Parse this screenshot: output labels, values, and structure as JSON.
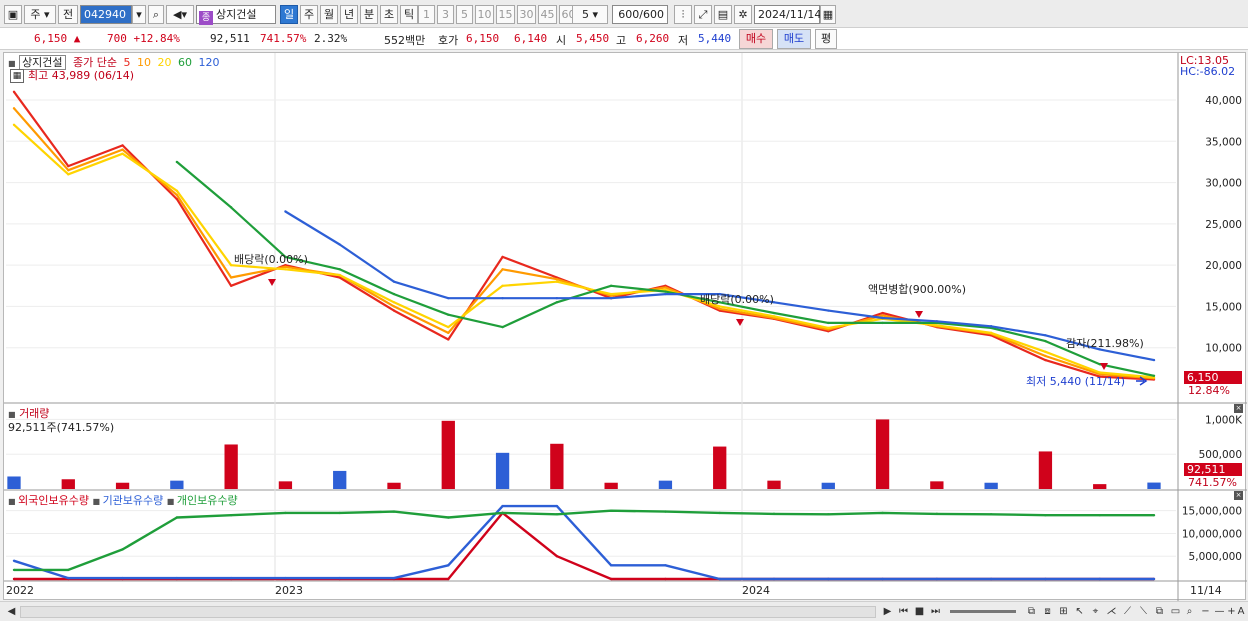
{
  "toolbar": {
    "market": "주",
    "scope": "전",
    "stock_code": "042940",
    "stock_badge": "종",
    "stock_name": "상지건설",
    "periods": [
      "일",
      "주",
      "월",
      "년",
      "분",
      "초",
      "틱"
    ],
    "selected_period": "일",
    "intervals": [
      "1",
      "3",
      "5",
      "10",
      "15",
      "30",
      "45",
      "60"
    ],
    "interval_value": "5",
    "count": "600/600",
    "date": "2024/11/14"
  },
  "quote": {
    "price": "6,150 ▲",
    "change": "700 +12.84%",
    "volume": "92,511",
    "volume_ratio": "741.57%",
    "turnover": "2.32%",
    "amount": "552백만",
    "bid_label": "호가",
    "bid1": "6,150",
    "bid2": "6,140",
    "open_label": "시",
    "open": "5,450",
    "high_label": "고",
    "high": "6,260",
    "low_label": "저",
    "low": "5,440",
    "buy_label": "매수",
    "sell_label": "매도",
    "flat_label": "평"
  },
  "price_panel": {
    "name": "상지건설",
    "indicator": "종가 단순",
    "ma_periods": [
      "5",
      "10",
      "20",
      "60",
      "120"
    ],
    "ma_colors": [
      "#e8281e",
      "#ff9a00",
      "#ffd400",
      "#1f9e3a",
      "#2d5fd6"
    ],
    "max_label": "최고 43,989 (06/14)",
    "min_label": "최저 5,440 (11/14)",
    "lc": "LC:13.05",
    "hc": "HC:-86.02",
    "current_price_tag": "6,150",
    "current_pct_tag": "12.84%",
    "events": [
      {
        "label": "배당락(0.00%)"
      },
      {
        "label": "배당락(0.00%)"
      },
      {
        "label": "액면병합(900.00%)"
      },
      {
        "label": "감자(211.98%)"
      }
    ]
  },
  "volume_panel": {
    "title": "거래량",
    "value_label": "92,511주(741.57%)",
    "current_tag": "92,511",
    "current_pct": "741.57%"
  },
  "holdings_panel": {
    "series_labels": [
      "외국인보유수량",
      "기관보유수량",
      "개인보유수량"
    ],
    "series_colors": [
      "#d0021b",
      "#2d5fd6",
      "#1f9e3a"
    ]
  },
  "x_axis": {
    "labels": [
      "2022",
      "2023",
      "2024"
    ],
    "last_label": "11/14"
  },
  "chart_data": [
    {
      "type": "line",
      "series": [
        {
          "name": "5",
          "values": [
            41000,
            32000,
            34500,
            28000,
            17500,
            20000,
            18500,
            14500,
            11000,
            21000,
            18500,
            16000,
            17500,
            14500,
            13500,
            12000,
            14200,
            12500,
            11500,
            8500,
            6500,
            6150
          ]
        },
        {
          "name": "10",
          "values": [
            39000,
            31500,
            34000,
            28500,
            18500,
            19800,
            18800,
            15000,
            11800,
            19500,
            18300,
            16300,
            17300,
            14700,
            13600,
            12200,
            13900,
            12600,
            11700,
            9000,
            6800,
            6300
          ]
        },
        {
          "name": "20",
          "values": [
            37000,
            31000,
            33500,
            29000,
            20000,
            19500,
            18800,
            15500,
            12500,
            17500,
            18000,
            16500,
            17000,
            15000,
            13800,
            12400,
            13500,
            12700,
            11800,
            9500,
            7000,
            6400
          ]
        },
        {
          "name": "60",
          "values": [
            null,
            null,
            null,
            32500,
            27000,
            21000,
            19500,
            16500,
            14000,
            12500,
            15500,
            17500,
            16800,
            15500,
            14200,
            13000,
            13000,
            13000,
            12400,
            10800,
            8000,
            6600
          ]
        },
        {
          "name": "120",
          "values": [
            null,
            null,
            null,
            null,
            null,
            26500,
            22500,
            18000,
            16000,
            16000,
            16000,
            16000,
            16500,
            16500,
            15500,
            14500,
            13600,
            13200,
            12600,
            11500,
            9800,
            8500
          ]
        }
      ],
      "y_ticks": [
        "40,000",
        "35,000",
        "30,000",
        "25,000",
        "20,000",
        "15,000",
        "10,000"
      ],
      "ylim": [
        5000,
        44000
      ]
    },
    {
      "type": "bar",
      "series": [
        {
          "name": "거래량",
          "values": [
            180000,
            140000,
            90000,
            120000,
            640000,
            110000,
            260000,
            90000,
            980000,
            520000,
            650000,
            90000,
            120000,
            610000,
            120000,
            90000,
            1000000,
            110000,
            90000,
            540000,
            70000,
            92511
          ]
        }
      ],
      "y_ticks": [
        "1,000K",
        "500,000"
      ],
      "ylim": [
        0,
        1150000
      ]
    },
    {
      "type": "line",
      "series": [
        {
          "name": "외국인보유수량",
          "values": [
            0,
            0,
            0,
            0,
            0,
            0,
            0,
            0,
            0,
            14500000,
            5000000,
            0,
            0,
            0,
            0,
            0,
            0,
            0,
            0,
            0,
            0,
            0
          ]
        },
        {
          "name": "기관보유수량",
          "values": [
            4000000,
            200000,
            200000,
            200000,
            200000,
            200000,
            200000,
            200000,
            3000000,
            16000000,
            16000000,
            3000000,
            3000000,
            0,
            0,
            0,
            0,
            0,
            0,
            0,
            0,
            0
          ]
        },
        {
          "name": "개인보유수량",
          "values": [
            2000000,
            2000000,
            6500000,
            13500000,
            14000000,
            14500000,
            14500000,
            14800000,
            13500000,
            14500000,
            14200000,
            15000000,
            14800000,
            14500000,
            14300000,
            14200000,
            14500000,
            14300000,
            14200000,
            14000000,
            14000000,
            14000000
          ]
        }
      ],
      "y_ticks": [
        "15,000,000",
        "10,000,000",
        "5,000,000"
      ],
      "ylim": [
        0,
        18000000
      ]
    }
  ]
}
